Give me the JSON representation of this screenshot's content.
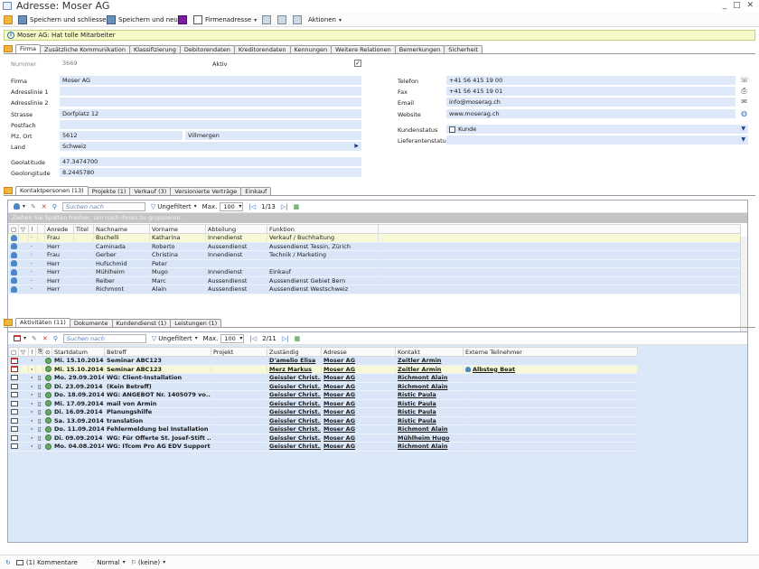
{
  "window": {
    "title": "Adresse: Moser AG",
    "controls": "_ □ ✕"
  },
  "toolbar": {
    "save_close": "Speichern und schliessen",
    "save_new": "Speichern und neu",
    "company_address": "Firmenadresse",
    "actions": "Aktionen"
  },
  "notice": "Moser AG: Hat tolle Mitarbeiter",
  "main_tabs": [
    "Firma",
    "Zusätzliche Kommunikation",
    "Klassifizierung",
    "Debitorendaten",
    "Kreditorendaten",
    "Kennungen",
    "Weitere Relationen",
    "Bemerkungen",
    "Sicherheit"
  ],
  "form": {
    "nummer_label": "Nummer",
    "nummer": "3669",
    "aktiv_label": "Aktiv",
    "firma_label": "Firma",
    "firma": "Moser AG",
    "adress1_label": "Adresslinie 1",
    "adress1": "",
    "adress2_label": "Adresslinie 2",
    "adress2": "",
    "strasse_label": "Strasse",
    "strasse": "Dorfplatz 12",
    "postfach_label": "Postfach",
    "postfach": "",
    "plzort_label": "Plz, Ort",
    "plz": "5612",
    "ort": "Villmergen",
    "land_label": "Land",
    "land": "Schweiz",
    "geolat_label": "Geolatitude",
    "geolat": "47.3474700",
    "geolong_label": "Geolongitude",
    "geolong": "8.2445780",
    "telefon_label": "Telefon",
    "telefon": "+41 56 415 19 00",
    "fax_label": "Fax",
    "fax": "+41 56 415 19 01",
    "email_label": "Email",
    "email": "info@moserag.ch",
    "website_label": "Website",
    "website": "www.moserag.ch",
    "kundenstatus_label": "Kundenstatus",
    "kundenstatus": "Kunde",
    "lieferantenstatus_label": "Lieferantenstatus",
    "lieferantenstatus": ""
  },
  "contact_tabs": [
    "Kontaktpersonen (13)",
    "Projekte (1)",
    "Verkauf (3)",
    "Versionierte Verträge",
    "Einkauf"
  ],
  "grid_toolbar": {
    "search_placeholder": "Suchen nach",
    "filter": "Ungefiltert",
    "max_label": "Max.",
    "max_value": "100"
  },
  "contacts": {
    "pager": "1/13",
    "group_hint": "Ziehen Sie Spalten hierher, um nach ihnen zu gruppieren.",
    "headers": [
      "Anrede",
      "Titel",
      "Nachname",
      "Vorname",
      "Abteilung",
      "Funktion"
    ],
    "rows": [
      [
        "Frau",
        "",
        "Buchelli",
        "Katharina",
        "Innendienst",
        "Verkauf / Buchhaltung"
      ],
      [
        "Herr",
        "",
        "Caminada",
        "Roberto",
        "Aussendienst",
        "Aussendienst Tessin, Zürich"
      ],
      [
        "Frau",
        "",
        "Gerber",
        "Christina",
        "Innendienst",
        "Technik / Marketing"
      ],
      [
        "Herr",
        "",
        "Hufschmid",
        "Peter",
        "",
        ""
      ],
      [
        "Herr",
        "",
        "Mühlheim",
        "Mugo",
        "Innendienst",
        "Einkauf"
      ],
      [
        "Herr",
        "",
        "Reiber",
        "Marc",
        "Aussendienst",
        "Aussendienst Gebiet Bern"
      ],
      [
        "Herr",
        "",
        "Richmont",
        "Alain",
        "Aussendienst",
        "Aussendienst Westschweiz"
      ]
    ]
  },
  "activity_tabs": [
    "Aktivitäten (11)",
    "Dokumente",
    "Kundendienst (1)",
    "Leistungen (1)"
  ],
  "activities": {
    "pager": "2/11",
    "headers": [
      "Startdatum",
      "Betreff",
      "Projekt",
      "Zuständig",
      "Adresse",
      "Kontakt",
      "Externe Teilnehmer"
    ],
    "rows": [
      [
        "cal",
        "Mi. 15.10.2014",
        "Seminar ABC123",
        "",
        "D'amelio Elisa",
        "Moser AG",
        "Zeitler Armin",
        ""
      ],
      [
        "cal",
        "Mi. 15.10.2014",
        "Seminar ABC123",
        "",
        "Merz Markus",
        "Moser AG",
        "Zeitler Armin",
        "Albsteg Beat"
      ],
      [
        "mail",
        "Mo. 29.09.2014",
        "WG: Client-Installation",
        "",
        "Geissler Christ...",
        "Moser AG",
        "Richmont Alain",
        ""
      ],
      [
        "mail",
        "Di. 23.09.2014",
        "(Kein Betreff)",
        "",
        "Geissler Christ...",
        "Moser AG",
        "Richmont Alain",
        ""
      ],
      [
        "mail",
        "Do. 18.09.2014",
        "WG: ANGEBOT Nr. 1405079 vo...",
        "",
        "Geissler Christ...",
        "Moser AG",
        "Ristic Paula",
        ""
      ],
      [
        "mail",
        "Mi. 17.09.2014",
        "mail von Armin",
        "",
        "Geissler Christ...",
        "Moser AG",
        "Ristic Paula",
        ""
      ],
      [
        "mail",
        "Di. 16.09.2014",
        "Planungshilfe",
        "",
        "Geissler Christ...",
        "Moser AG",
        "Ristic Paula",
        ""
      ],
      [
        "mail",
        "Sa. 13.09.2014",
        "translation",
        "",
        "Geissler Christ...",
        "Moser AG",
        "Ristic Paula",
        ""
      ],
      [
        "mail",
        "Do. 11.09.2014",
        "Fehlermeldung bei Installation",
        "",
        "Geissler Christ...",
        "Moser AG",
        "Richmont Alain",
        ""
      ],
      [
        "mail",
        "Di. 09.09.2014",
        "WG: Für Offerte St. Josef-Stift ...",
        "",
        "Geissler Christ...",
        "Moser AG",
        "Mühlheim Hugo",
        ""
      ],
      [
        "mail",
        "Mo. 04.08.2014",
        "WG: ITcom Pro AG EDV Support",
        "",
        "Geissler Christ...",
        "Moser AG",
        "Richmont Alain",
        ""
      ]
    ]
  },
  "statusbar": {
    "comments": "(1) Kommentare",
    "priority": "Normal",
    "flag": "(keine)"
  },
  "colors": {
    "field_bg": "#dde9f8",
    "notice_bg": "#f6f9c8",
    "row_bg": "#d8e6f8",
    "selected_row": "#f6f8d6",
    "accent": "#2e6fb7"
  }
}
